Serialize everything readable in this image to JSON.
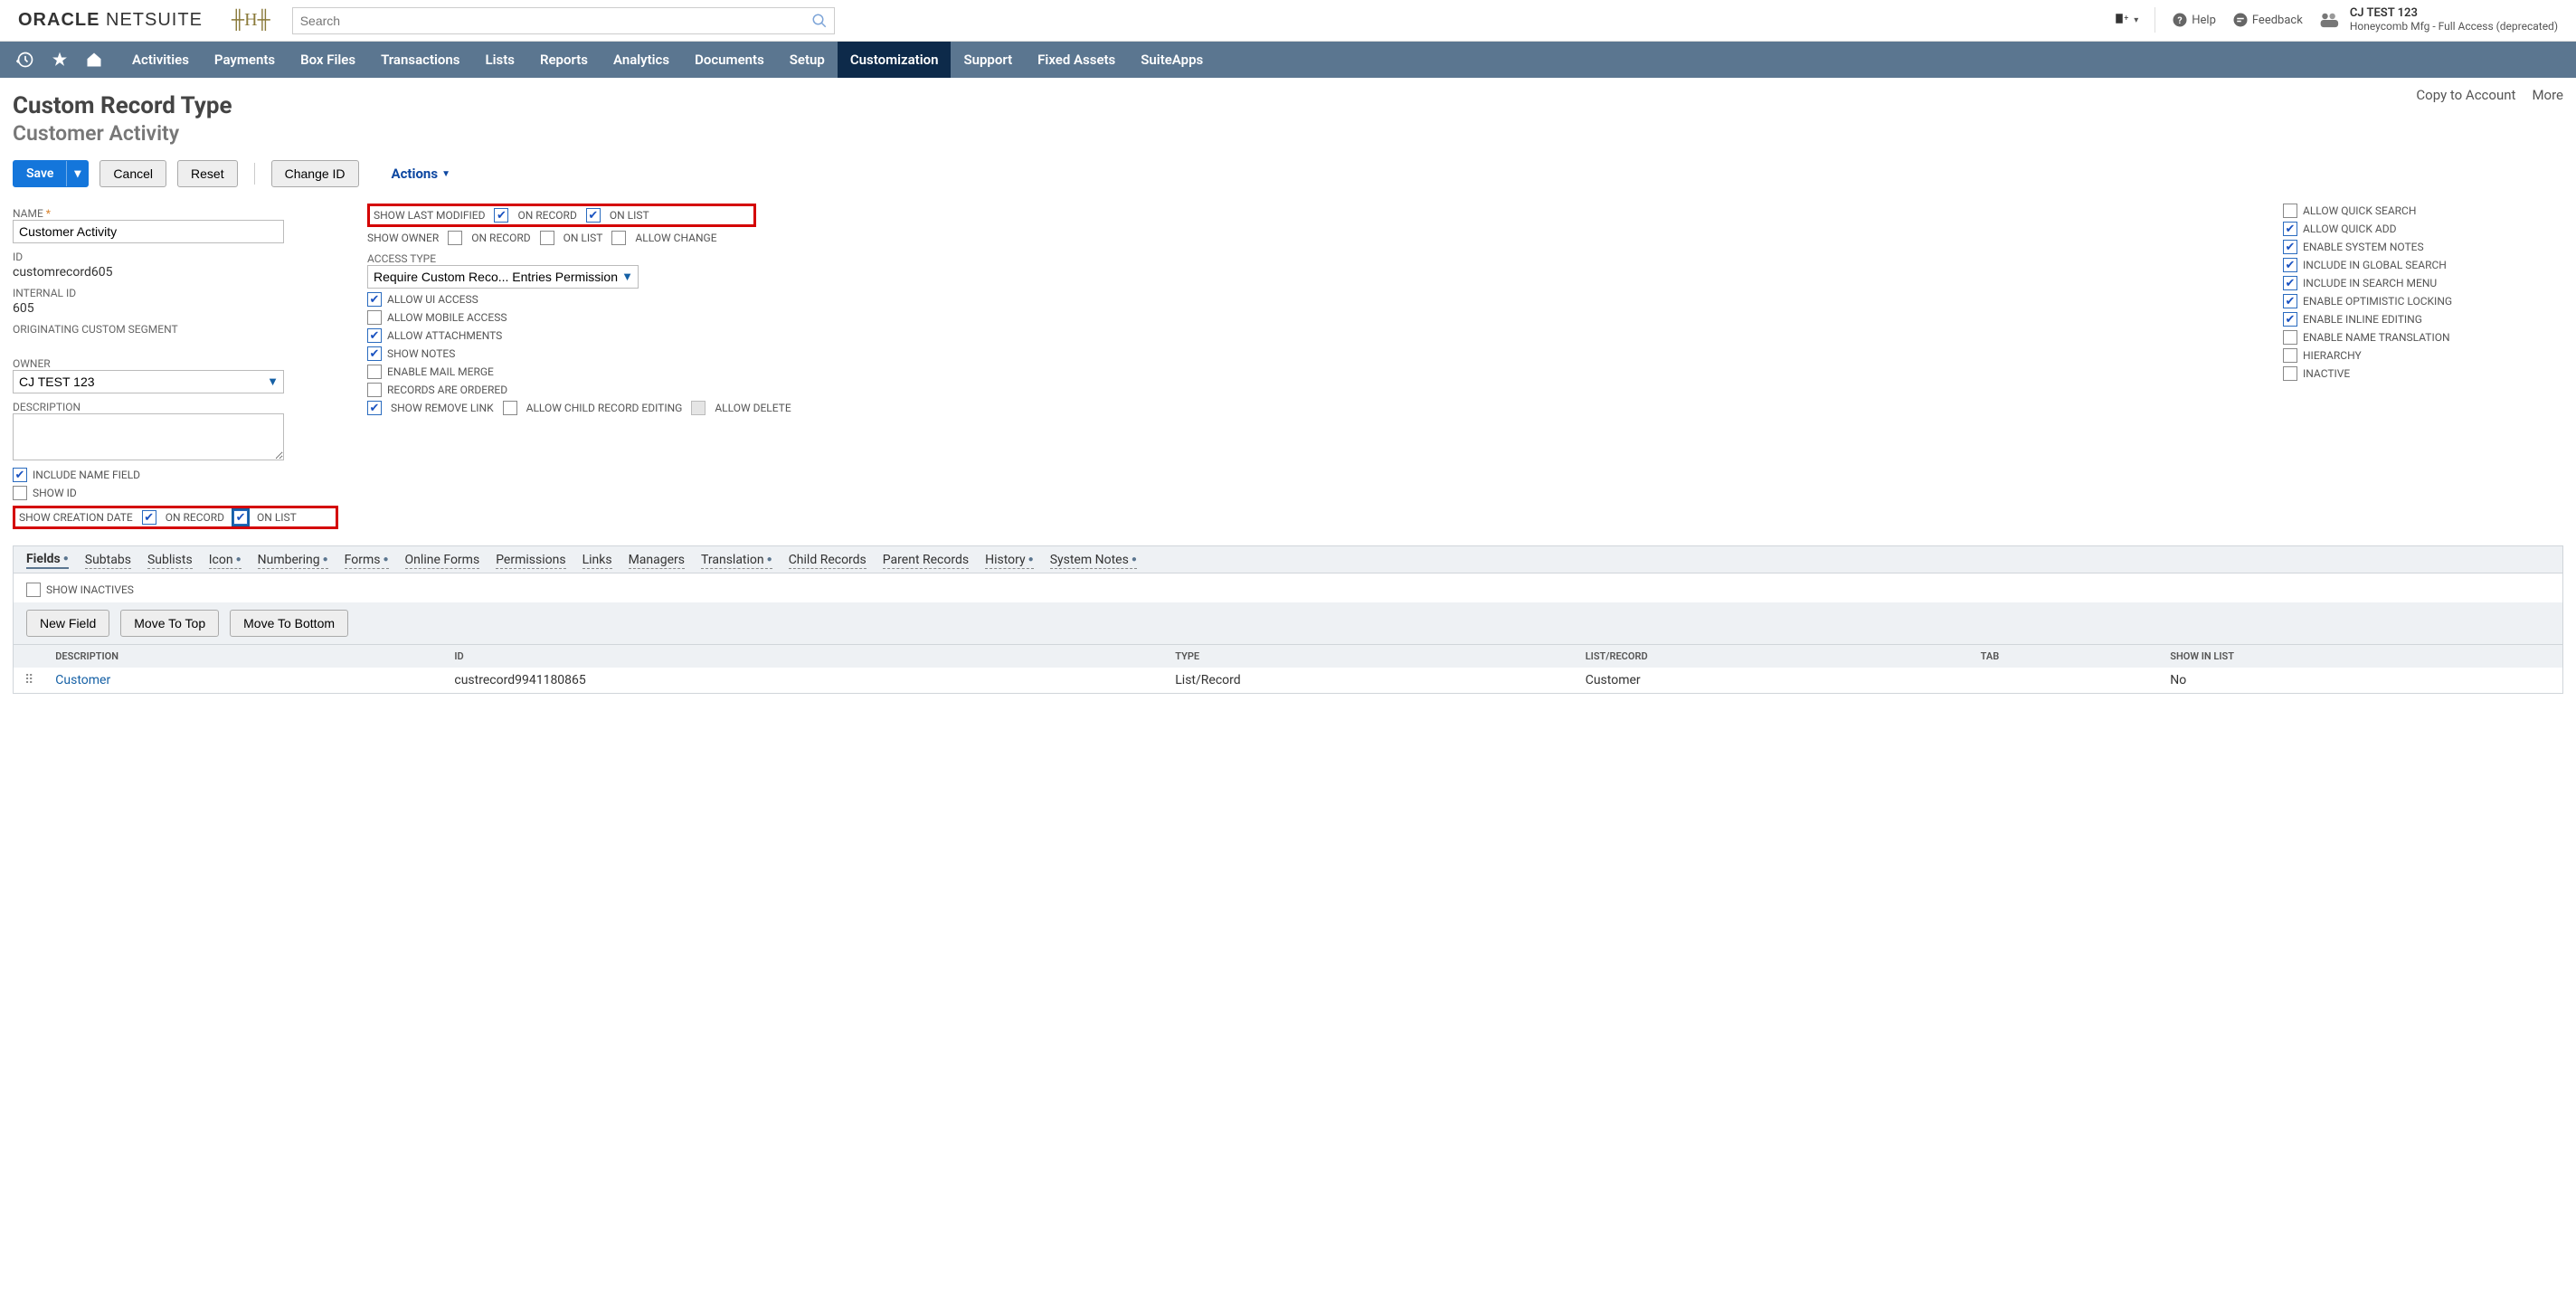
{
  "brand": {
    "left": "ORACLE",
    "right": "NETSUITE"
  },
  "search": {
    "placeholder": "Search"
  },
  "topRight": {
    "help": "Help",
    "feedback": "Feedback",
    "userName": "CJ TEST 123",
    "userRole": "Honeycomb Mfg - Full Access (deprecated)"
  },
  "nav": [
    "Activities",
    "Payments",
    "Box Files",
    "Transactions",
    "Lists",
    "Reports",
    "Analytics",
    "Documents",
    "Setup",
    "Customization",
    "Support",
    "Fixed Assets",
    "SuiteApps"
  ],
  "navActiveIndex": 9,
  "page": {
    "title": "Custom Record Type",
    "subtitle": "Customer Activity",
    "copyLink": "Copy to Account",
    "moreLink": "More"
  },
  "buttons": {
    "save": "Save",
    "cancel": "Cancel",
    "reset": "Reset",
    "changeId": "Change ID",
    "actions": "Actions"
  },
  "col1": {
    "nameLabel": "NAME",
    "nameValue": "Customer Activity",
    "idLabel": "ID",
    "idValue": "customrecord605",
    "internalIdLabel": "INTERNAL ID",
    "internalIdValue": "605",
    "segLabel": "ORIGINATING CUSTOM SEGMENT",
    "ownerLabel": "OWNER",
    "ownerValue": "CJ TEST 123",
    "descLabel": "DESCRIPTION",
    "includeName": "INCLUDE NAME FIELD",
    "showId": "SHOW ID",
    "showCreation": "SHOW CREATION DATE",
    "onRecord": "ON RECORD",
    "onList": "ON LIST"
  },
  "col2": {
    "showLastMod": "SHOW LAST MODIFIED",
    "onRecord": "ON RECORD",
    "onList": "ON LIST",
    "showOwner": "SHOW OWNER",
    "allowChange": "ALLOW CHANGE",
    "accessTypeLabel": "ACCESS TYPE",
    "accessTypeValue": "Require Custom Reco... Entries Permission",
    "allowUi": "ALLOW UI ACCESS",
    "allowMobile": "ALLOW MOBILE ACCESS",
    "allowAttach": "ALLOW ATTACHMENTS",
    "showNotes": "SHOW NOTES",
    "mailMerge": "ENABLE MAIL MERGE",
    "ordered": "RECORDS ARE ORDERED",
    "removeLink": "SHOW REMOVE LINK",
    "childEdit": "ALLOW CHILD RECORD EDITING",
    "allowDelete": "ALLOW DELETE"
  },
  "col3": {
    "quickSearch": "ALLOW QUICK SEARCH",
    "quickAdd": "ALLOW QUICK ADD",
    "sysNotes": "ENABLE SYSTEM NOTES",
    "globalSearch": "INCLUDE IN GLOBAL SEARCH",
    "searchMenu": "INCLUDE IN SEARCH MENU",
    "optLock": "ENABLE OPTIMISTIC LOCKING",
    "inlineEdit": "ENABLE INLINE EDITING",
    "nameTrans": "ENABLE NAME TRANSLATION",
    "hierarchy": "HIERARCHY",
    "inactive": "INACTIVE"
  },
  "subtabs": [
    {
      "label": "Fields",
      "dot": true,
      "active": true
    },
    {
      "label": "Subtabs",
      "dot": false
    },
    {
      "label": "Sublists",
      "dot": false
    },
    {
      "label": "Icon",
      "dot": true
    },
    {
      "label": "Numbering",
      "dot": true
    },
    {
      "label": "Forms",
      "dot": true
    },
    {
      "label": "Online Forms",
      "dot": false
    },
    {
      "label": "Permissions",
      "dot": false
    },
    {
      "label": "Links",
      "dot": false
    },
    {
      "label": "Managers",
      "dot": false
    },
    {
      "label": "Translation",
      "dot": true
    },
    {
      "label": "Child Records",
      "dot": false
    },
    {
      "label": "Parent Records",
      "dot": false
    },
    {
      "label": "History",
      "dot": true
    },
    {
      "label": "System Notes",
      "dot": true
    }
  ],
  "showInactives": "SHOW INACTIVES",
  "fieldButtons": {
    "newField": "New Field",
    "moveTop": "Move To Top",
    "moveBottom": "Move To Bottom"
  },
  "grid": {
    "headers": [
      "",
      "DESCRIPTION",
      "ID",
      "TYPE",
      "LIST/RECORD",
      "TAB",
      "SHOW IN LIST"
    ],
    "row": {
      "desc": "Customer",
      "id": "custrecord9941180865",
      "type": "List/Record",
      "listrec": "Customer",
      "tab": "",
      "show": "No"
    }
  }
}
